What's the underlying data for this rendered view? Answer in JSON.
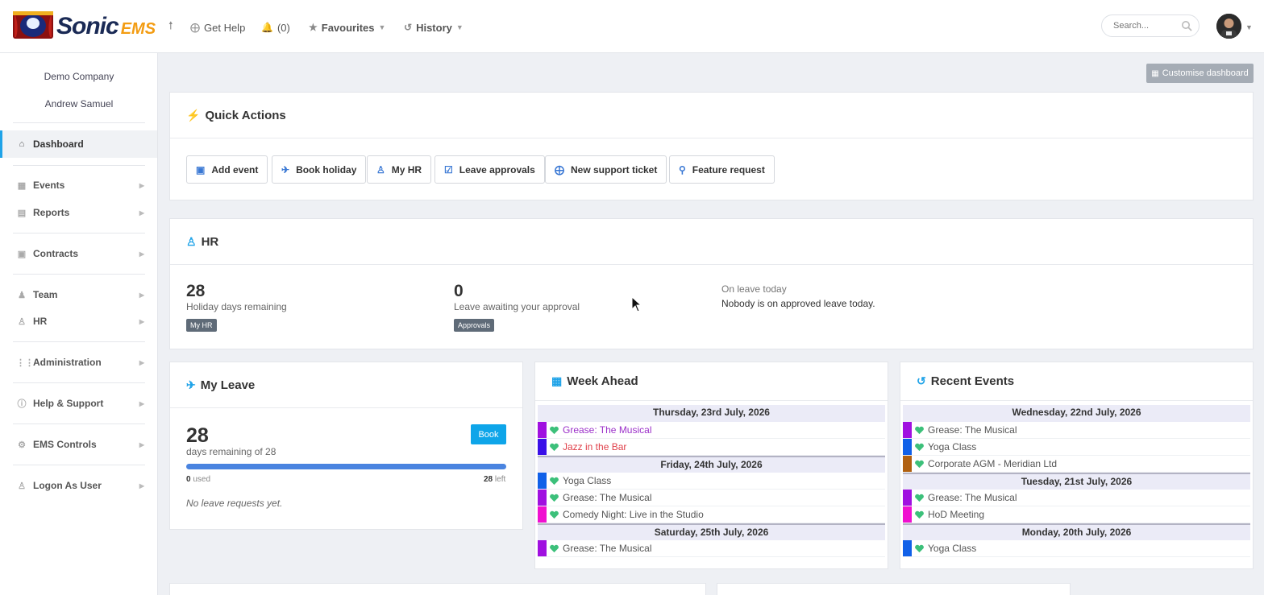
{
  "header": {
    "logo_text": "Sonic",
    "logo_suffix": "EMS",
    "get_help": "Get Help",
    "notifications": "(0)",
    "favourites": "Favourites",
    "history": "History",
    "search_placeholder": "Search..."
  },
  "sidebar": {
    "company": "Demo Company",
    "user": "Andrew Samuel",
    "items": [
      {
        "label": "Dashboard",
        "icon": "home-icon",
        "active": true
      },
      {
        "label": "Events",
        "icon": "calendar-grid-icon"
      },
      {
        "label": "Reports",
        "icon": "report-icon"
      },
      {
        "label": "Contracts",
        "icon": "document-icon"
      },
      {
        "label": "Team",
        "icon": "team-icon"
      },
      {
        "label": "HR",
        "icon": "person-icon"
      },
      {
        "label": "Administration",
        "icon": "sliders-icon"
      },
      {
        "label": "Help & Support",
        "icon": "help-icon"
      },
      {
        "label": "EMS Controls",
        "icon": "gear-icon"
      },
      {
        "label": "Logon As User",
        "icon": "user-login-icon"
      }
    ]
  },
  "toolbar": {
    "customise": "Customise dashboard"
  },
  "quick_actions": {
    "title": "Quick Actions",
    "buttons": [
      {
        "label": "Add event",
        "icon": "calendar-plus-icon"
      },
      {
        "label": "Book holiday",
        "icon": "plane-icon"
      },
      {
        "label": "My HR",
        "icon": "person-icon"
      },
      {
        "label": "Leave approvals",
        "icon": "checkbox-icon"
      },
      {
        "label": "New support ticket",
        "icon": "lifebuoy-icon"
      },
      {
        "label": "Feature request",
        "icon": "lightbulb-icon"
      }
    ]
  },
  "hr": {
    "title": "HR",
    "holiday_days": "28",
    "holiday_label": "Holiday days remaining",
    "holiday_badge": "My HR",
    "awaiting": "0",
    "awaiting_label": "Leave awaiting your approval",
    "awaiting_badge": "Approvals",
    "on_leave_title": "On leave today",
    "on_leave_text": "Nobody is on approved leave today."
  },
  "my_leave": {
    "title": "My Leave",
    "days": "28",
    "days_label": "days remaining of 28",
    "book": "Book",
    "used_num": "0",
    "used_label": "used",
    "left_num": "28",
    "left_label": "left",
    "used_fraction": 1.0,
    "none": "No leave requests yet."
  },
  "week_ahead": {
    "title": "Week Ahead",
    "groups": [
      {
        "day": "Thursday, 23rd July, 2026",
        "events": [
          {
            "name": "Grease: The Musical",
            "color": "#a010e0",
            "text_color": "#9b2fc9"
          },
          {
            "name": "Jazz in the Bar",
            "color": "#3a10e8",
            "text_color": "#e0404a"
          }
        ]
      },
      {
        "day": "Friday, 24th July, 2026",
        "events": [
          {
            "name": "Yoga Class",
            "color": "#1060e8",
            "text_color": "#555555"
          },
          {
            "name": "Grease: The Musical",
            "color": "#a010e0",
            "text_color": "#555555"
          },
          {
            "name": "Comedy Night: Live in the Studio",
            "color": "#f010d0",
            "text_color": "#555555"
          }
        ]
      },
      {
        "day": "Saturday, 25th July, 2026",
        "events": [
          {
            "name": "Grease: The Musical",
            "color": "#a010e0",
            "text_color": "#555555"
          }
        ]
      }
    ]
  },
  "recent_events": {
    "title": "Recent Events",
    "groups": [
      {
        "day": "Wednesday, 22nd July, 2026",
        "events": [
          {
            "name": "Grease: The Musical",
            "color": "#a010e0",
            "text_color": "#555555"
          },
          {
            "name": "Yoga Class",
            "color": "#1060e8",
            "text_color": "#555555"
          },
          {
            "name": "Corporate AGM - Meridian Ltd",
            "color": "#b06010",
            "text_color": "#555555"
          }
        ]
      },
      {
        "day": "Tuesday, 21st July, 2026",
        "events": [
          {
            "name": "Grease: The Musical",
            "color": "#a010e0",
            "text_color": "#555555"
          },
          {
            "name": "HoD Meeting",
            "color": "#f010d0",
            "text_color": "#555555"
          }
        ]
      },
      {
        "day": "Monday, 20th July, 2026",
        "events": [
          {
            "name": "Yoga Class",
            "color": "#1060e8",
            "text_color": "#555555"
          }
        ]
      }
    ]
  }
}
